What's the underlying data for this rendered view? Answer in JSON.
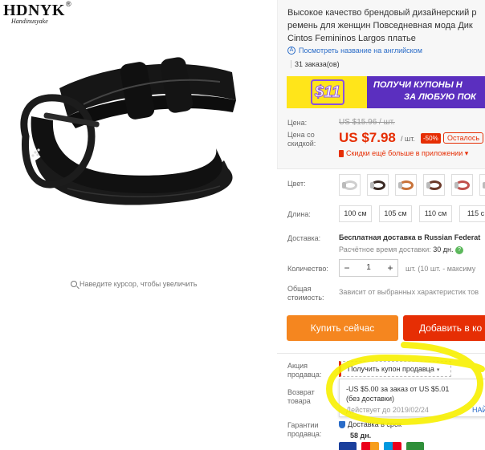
{
  "brand": {
    "name": "HDNYK",
    "reg": "®",
    "tagline": "Handinusyake"
  },
  "zoom_hint": "Наведите курсор, чтобы увеличить",
  "product": {
    "title_lines": [
      "Высокое качество брендовый дизайнерский р",
      "ремень для женщин Повседневная мода Дик",
      "Cintos Femininos Largos платье"
    ],
    "translate_link": "Посмотреть название на английском",
    "orders": "31 заказа(ов)"
  },
  "coupon_banner": {
    "amount": "$11",
    "line1": "ПОЛУЧИ КУПОНЫ Н",
    "line2": "ЗА ЛЮБУЮ ПОК"
  },
  "price": {
    "old_label": "Цена:",
    "old_value": "US $15.96 / шт.",
    "discount_label_line1": "Цена со",
    "discount_label_line2": "скидкой:",
    "new_value": "US $7.98",
    "per_unit": "/ шт.",
    "discount_badge": "-50%",
    "remaining_badge": "Осталось",
    "app_discount": "Скидки ещё больше в приложении ▾"
  },
  "options": {
    "color_label": "Цвет:",
    "swatch_colors": [
      "#cfcfcf",
      "#3a2a24",
      "#c8733a",
      "#6b3a2a",
      "#c0504d",
      "#8a5a3c"
    ],
    "length_label": "Длина:",
    "lengths": [
      "100 см",
      "105 см",
      "110 см",
      "115 с"
    ]
  },
  "delivery": {
    "label": "Доставка:",
    "text_bold": "Бесплатная доставка в ",
    "text_rest": "Russian Federat",
    "time_prefix": "Расчётное время доставки: ",
    "time_value": "30 дн.",
    "help": "?"
  },
  "quantity": {
    "label": "Количество:",
    "minus": "−",
    "value": "1",
    "plus": "+",
    "note": "шт. (10 шт. - максиму"
  },
  "total": {
    "label_line1": "Общая",
    "label_line2": "стоимость:",
    "text": "Зависит от выбранных характеристик тов"
  },
  "actions": {
    "buy_now": "Купить сейчас",
    "add_to_cart": "Добавить в ко"
  },
  "promo": {
    "label_line1": "Акция",
    "label_line2": "продавца:",
    "select_text": "Получить купон продавца",
    "caret": "▾",
    "desc_line1": "-US $5.00 за заказ от US $5.01",
    "desc_line2": "(без доставки)",
    "valid": "Действует до 2019/02/24",
    "get": "НАЙТ"
  },
  "returns": {
    "label_line1": "Возврат",
    "label_line2": "товара"
  },
  "guarantee": {
    "label_line1": "Гарантии",
    "label_line2": "продавца:",
    "text": "Доставка в срок",
    "days": "58 дн."
  },
  "colors": {
    "accent_red": "#e62e04",
    "buy_orange": "#f5861f",
    "banner_purple": "#5b2fbf",
    "banner_yellow": "#ffe51a",
    "highlight_yellow": "#f7f000"
  }
}
